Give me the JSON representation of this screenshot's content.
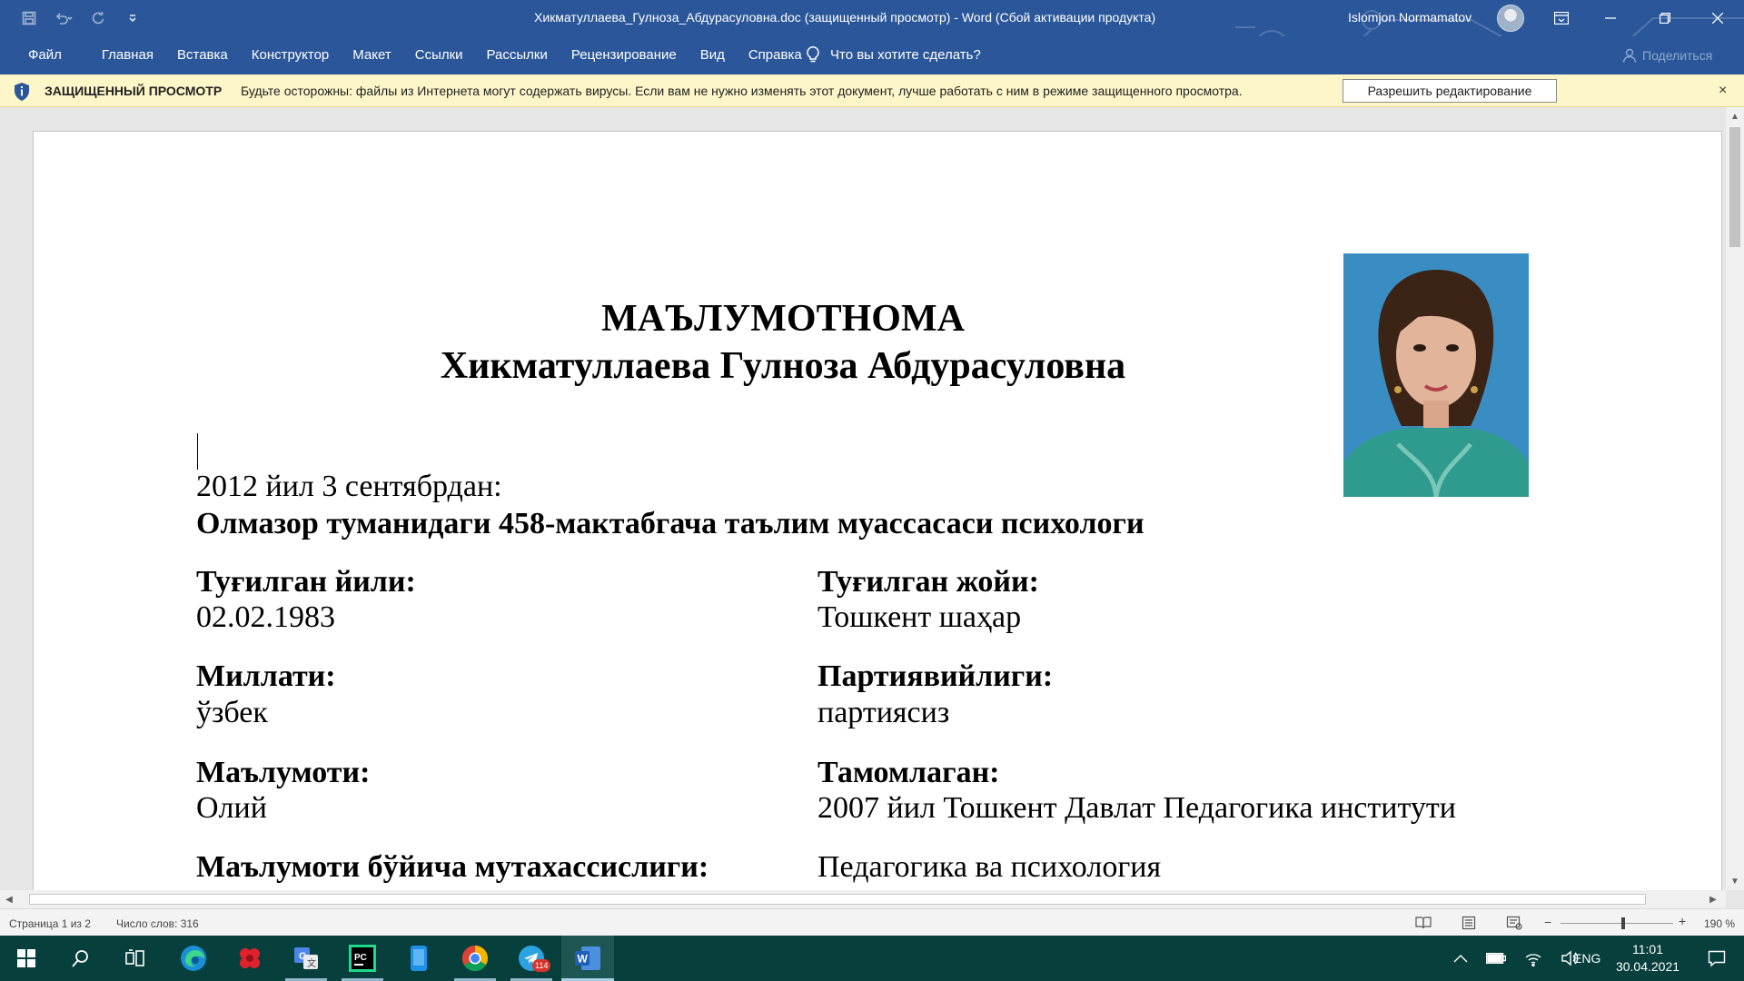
{
  "titlebar": {
    "document_title": "Хикматуллаева_Гулноза_Абдурасуловна.doc (защищенный просмотр)  -  Word (Сбой активации продукта)",
    "user_name": "Islomjon Normamatov",
    "qat_icons": [
      "save-icon",
      "undo-icon",
      "redo-icon",
      "customize-icon"
    ],
    "window_controls": [
      "ribbon-display-icon",
      "minimize-icon",
      "restore-icon",
      "close-icon"
    ]
  },
  "ribbon": {
    "tabs": [
      "Файл",
      "Главная",
      "Вставка",
      "Конструктор",
      "Макет",
      "Ссылки",
      "Рассылки",
      "Рецензирование",
      "Вид",
      "Справка"
    ],
    "tell_me": "Что вы хотите сделать?",
    "share": "Поделиться"
  },
  "protected_view": {
    "title": "ЗАЩИЩЕННЫЙ ПРОСМОТР",
    "message": "Будьте осторожны: файлы из Интернета могут содержать вирусы. Если вам не нужно изменять этот документ, лучше работать с ним в режиме защищенного просмотра.",
    "enable_button": "Разрешить редактирование",
    "close": "×"
  },
  "document": {
    "heading_line1": "МАЪЛУМОТНОМА",
    "heading_line2": "Хикматуллаева Гулноза Абдурасуловна",
    "since_label": "2012 йил 3 сентябрдан:",
    "position": "Олмазор туманидаги 458-мактабгача таълим муассасаси психологи",
    "birth_year_label": "Туғилган йили:",
    "birth_year": "02.02.1983",
    "birth_place_label": "Туғилган жойи:",
    "birth_place": "Тошкент шаҳар",
    "nationality_label": "Миллати:",
    "nationality": "ўзбек",
    "party_label": "Партиявийлиги:",
    "party": "партиясиз",
    "education_label": "Маълумоти:",
    "education": "Олий",
    "graduated_label": "Тамомлаган:",
    "graduated": "2007 йил Тошкент Давлат Педагогика институти",
    "specialty_label": "Маълумоти бўйича мутахассислиги:",
    "specialty": "Педагогика ва психология"
  },
  "statusbar": {
    "page_info": "Страница 1 из 2",
    "word_count": "Число слов: 316",
    "zoom_minus": "−",
    "zoom_plus": "+",
    "zoom": "190 %",
    "zoom_fraction": 0.56,
    "view_icons": [
      "read-mode-icon",
      "print-layout-icon",
      "web-layout-icon"
    ]
  },
  "taskbar": {
    "apps": [
      "start-icon",
      "search-icon",
      "task-view-icon",
      "edge-icon",
      "app-red-icon",
      "translate-icon",
      "pycharm-icon",
      "phone-app-icon",
      "chrome-icon",
      "telegram-icon",
      "word-icon"
    ],
    "telegram_badge": "114",
    "language": "ENG",
    "time": "11:01",
    "date": "30.04.2021"
  },
  "colors": {
    "ribbon": "#2b579a",
    "protected_bar": "#fdf6c8",
    "taskbar": "#073f3c"
  }
}
